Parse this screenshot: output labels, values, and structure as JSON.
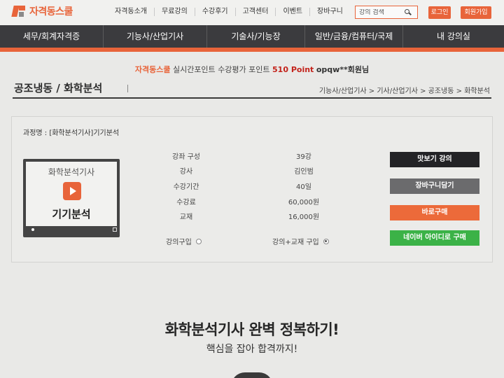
{
  "header": {
    "logo_text": "자격동스쿨",
    "nav": [
      "자격동소개",
      "무료강의",
      "수강후기",
      "고객센터",
      "이벤트",
      "장바구니"
    ],
    "search_placeholder": "강의 검색",
    "login_label": "로그인",
    "join_label": "회원가입"
  },
  "main_nav": [
    "세무/회계자격증",
    "기능사/산업기사",
    "기술사/기능장",
    "일반/금융/컴퓨터/국제",
    "내 강의실"
  ],
  "points_bar": {
    "brand": "자격동스쿨",
    "text1": "실시간포인트",
    "text2": "수강평가 포인트",
    "points": "510 Point",
    "user": "opqw**회원님"
  },
  "page": {
    "title": "공조냉동 / 화학분석",
    "breadcrumb": "기능사/산업기사 > 기사/산업기사 > 공조냉동 > 화학분석"
  },
  "course": {
    "name": "과정명 : [화학분석기사]기기분석",
    "thumb_top": "화학분석기사",
    "thumb_bottom": "기기분석",
    "info": [
      {
        "label": "강좌 구성",
        "value": "39강"
      },
      {
        "label": "강사",
        "value": "김인범"
      },
      {
        "label": "수강기간",
        "value": "40일"
      },
      {
        "label": "수강료",
        "value": "60,000원"
      },
      {
        "label": "교재",
        "value": "16,000원"
      }
    ],
    "options": [
      {
        "label": "강의구입",
        "selected": false
      },
      {
        "label": "강의+교재 구입",
        "selected": true
      }
    ],
    "buttons": {
      "preview": "맛보기 강의",
      "cart": "장바구니담기",
      "buy": "바로구매",
      "naver": "네이버 아이디로 구매"
    }
  },
  "promo": {
    "headline": "화학분석기사 완벽 정복하기!",
    "subline": "핵심을 잡아 합격까지!"
  },
  "colors": {
    "accent": "#e8643a",
    "nav_bg": "#3b3b3e",
    "naver_green": "#3bb247"
  }
}
